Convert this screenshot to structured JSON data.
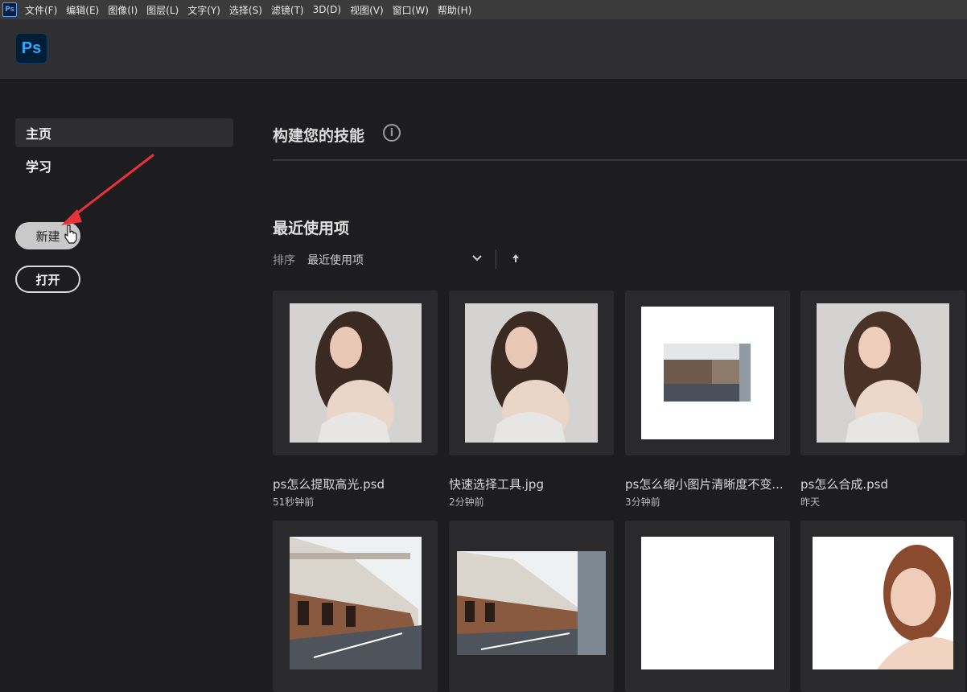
{
  "menubar": {
    "app_icon": "Ps",
    "items": [
      "文件(F)",
      "编辑(E)",
      "图像(I)",
      "图层(L)",
      "文字(Y)",
      "选择(S)",
      "滤镜(T)",
      "3D(D)",
      "视图(V)",
      "窗口(W)",
      "帮助(H)"
    ]
  },
  "header": {
    "logo": "Ps"
  },
  "sidebar": {
    "nav": [
      {
        "label": "主页",
        "active": true
      },
      {
        "label": "学习",
        "active": false
      }
    ],
    "new_button": "新建",
    "open_button": "打开"
  },
  "main": {
    "skills_title": "构建您的技能",
    "info_icon": "i",
    "recent_title": "最近使用项",
    "sort_label": "排序",
    "sort_value": "最近使用项",
    "files": [
      {
        "name": "ps怎么提取高光.psd",
        "time": "51秒钟前",
        "thumb": "portrait"
      },
      {
        "name": "快速选择工具.jpg",
        "time": "2分钟前",
        "thumb": "portrait"
      },
      {
        "name": "ps怎么缩小图片清晰度不变...",
        "time": "3分钟前",
        "thumb": "street-small"
      },
      {
        "name": "ps怎么合成.psd",
        "time": "昨天",
        "thumb": "portrait"
      },
      {
        "name": "",
        "time": "",
        "thumb": "street"
      },
      {
        "name": "",
        "time": "",
        "thumb": "street-wide"
      },
      {
        "name": "",
        "time": "",
        "thumb": "blank"
      },
      {
        "name": "",
        "time": "",
        "thumb": "portrait-2"
      }
    ]
  }
}
